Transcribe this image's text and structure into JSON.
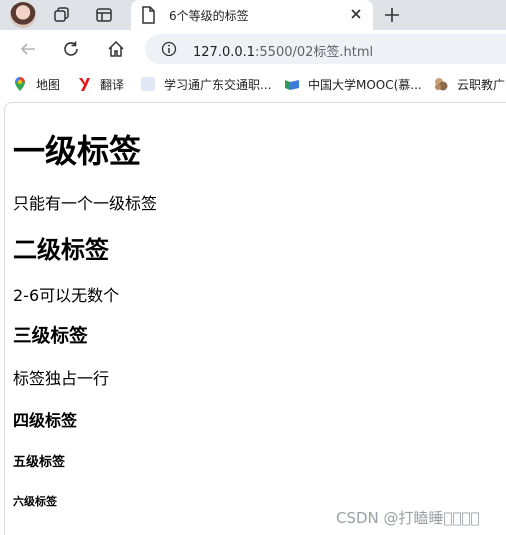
{
  "browser": {
    "tab": {
      "title": "6个等级的标签"
    },
    "address": {
      "host": "127.0.0.1",
      "path": ":5500/02标签.html"
    },
    "bookmarks": [
      {
        "label": "地图",
        "icon": "maps-icon"
      },
      {
        "label": "翻译",
        "icon": "translate-icon"
      },
      {
        "label": "学习通广东交通职...",
        "icon": "page-icon"
      },
      {
        "label": "中国大学MOOC(慕...",
        "icon": "mooc-icon"
      },
      {
        "label": "云职教广",
        "icon": "cloud-edu-icon"
      }
    ]
  },
  "page": {
    "h1": "一级标签",
    "p1": "只能有一个一级标签",
    "h2": "二级标签",
    "p2": "2-6可以无数个",
    "h3": "三级标签",
    "p3": "标签独占一行",
    "h4": "四级标签",
    "h5": "五级标签",
    "h6": "六级标签"
  },
  "watermark": "CSDN @打瞌睡\u0000\u0000\u0000\u0000"
}
